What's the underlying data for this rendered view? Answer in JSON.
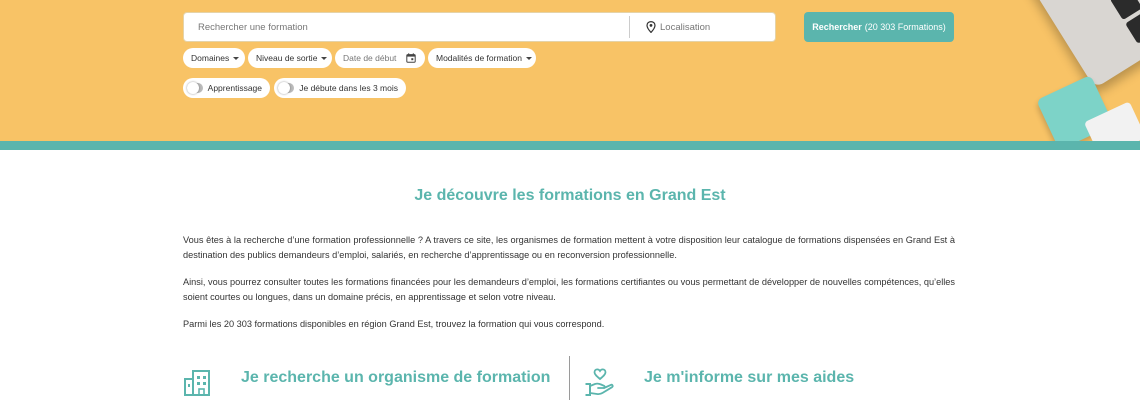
{
  "search": {
    "placeholder": "Rechercher une formation",
    "location_placeholder": "Localisation",
    "button_label_bold": "Rechercher",
    "button_label_count": "(20 303 Formations)"
  },
  "filters": [
    {
      "label": "Domaines",
      "type": "dropdown"
    },
    {
      "label": "Niveau de sortie",
      "type": "dropdown"
    },
    {
      "label": "Date de début",
      "type": "date"
    },
    {
      "label": "Modalités de formation",
      "type": "dropdown"
    }
  ],
  "toggles": [
    {
      "label": "Apprentissage",
      "checked": false
    },
    {
      "label": "Je débute dans les 3 mois",
      "checked": false
    }
  ],
  "main": {
    "title": "Je découvre les formations en Grand Est",
    "paragraphs": [
      "Vous êtes à la recherche d’une formation professionnelle ? A travers ce site, les organismes de formation mettent à votre disposition leur catalogue de formations dispensées en Grand Est à destination des publics demandeurs d’emploi, salariés, en recherche d’apprentissage ou en reconversion professionnelle.",
      "Ainsi, vous pourrez consulter toutes les formations financées pour les demandeurs d’emploi, les formations certifiantes ou vous permettant de développer de nouvelles compétences, qu’elles soient courtes ou longues, dans un domaine précis, en apprentissage et selon votre niveau.",
      "Parmi les 20 303 formations disponibles en région Grand Est, trouvez la formation qui vous correspond."
    ]
  },
  "cards": [
    {
      "label": "Je recherche un organisme de formation",
      "icon": "building-icon"
    },
    {
      "label": "Je m'informe sur mes aides",
      "icon": "hand-heart-icon"
    }
  ],
  "colors": {
    "hero": "#f8c366",
    "accent": "#5bb5ad"
  }
}
